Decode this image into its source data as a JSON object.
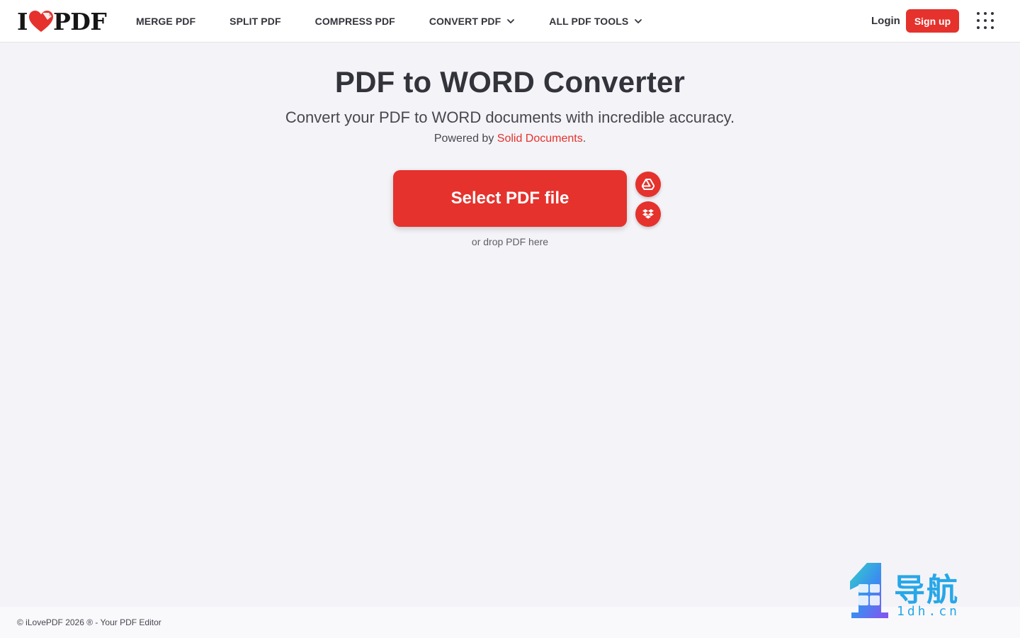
{
  "header": {
    "logo": {
      "left_text": "I",
      "right_text": "PDF"
    },
    "nav": [
      {
        "label": "MERGE PDF",
        "has_dropdown": false
      },
      {
        "label": "SPLIT PDF",
        "has_dropdown": false
      },
      {
        "label": "COMPRESS PDF",
        "has_dropdown": false
      },
      {
        "label": "CONVERT PDF",
        "has_dropdown": true
      },
      {
        "label": "ALL PDF TOOLS",
        "has_dropdown": true
      }
    ],
    "login_label": "Login",
    "signup_label": "Sign up",
    "apps_icon": "grid-dots-icon"
  },
  "main": {
    "title": "PDF to WORD Converter",
    "subtitle": "Convert your PDF to WORD documents with incredible accuracy.",
    "powered_prefix": "Powered by ",
    "powered_link": "Solid Documents",
    "powered_suffix": ".",
    "select_button_label": "Select PDF file",
    "cloud_buttons": [
      {
        "icon": "google-drive-icon"
      },
      {
        "icon": "dropbox-icon"
      }
    ],
    "drop_hint": "or drop PDF here"
  },
  "footer": {
    "copyright": "© iLovePDF 2026 ® - Your PDF Editor"
  },
  "watermark": {
    "text_cn": "导航",
    "text_en": "1dh.cn"
  },
  "colors": {
    "brand_red": "#e5322d",
    "background": "#f4f3f7",
    "text_dark": "#33333b",
    "watermark_blue": "#27a7e8"
  }
}
